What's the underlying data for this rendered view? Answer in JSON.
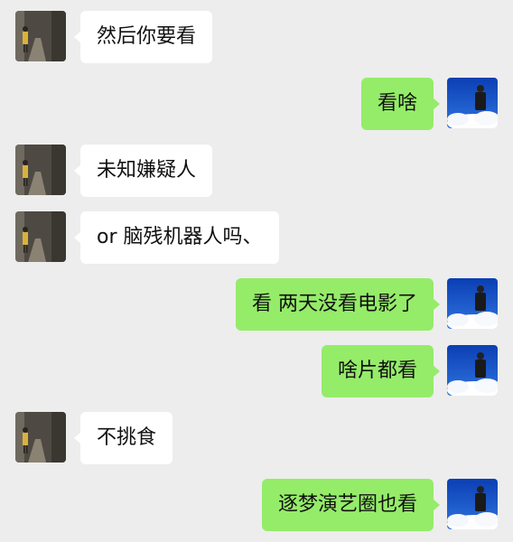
{
  "colors": {
    "background": "#ededed",
    "incoming_bubble": "#ffffff",
    "outgoing_bubble": "#95ec69"
  },
  "contact_avatar": "alley-person-photo",
  "self_avatar": "sky-cloud-person-photo",
  "messages": [
    {
      "side": "left",
      "text": "然后你要看"
    },
    {
      "side": "right",
      "text": "看啥"
    },
    {
      "side": "left",
      "text": "未知嫌疑人"
    },
    {
      "side": "left",
      "text": "or 脑残机器人吗、"
    },
    {
      "side": "right",
      "text": "看 两天没看电影了"
    },
    {
      "side": "right",
      "text": "啥片都看"
    },
    {
      "side": "left",
      "text": "不挑食"
    },
    {
      "side": "right",
      "text": "逐梦演艺圈也看"
    }
  ]
}
